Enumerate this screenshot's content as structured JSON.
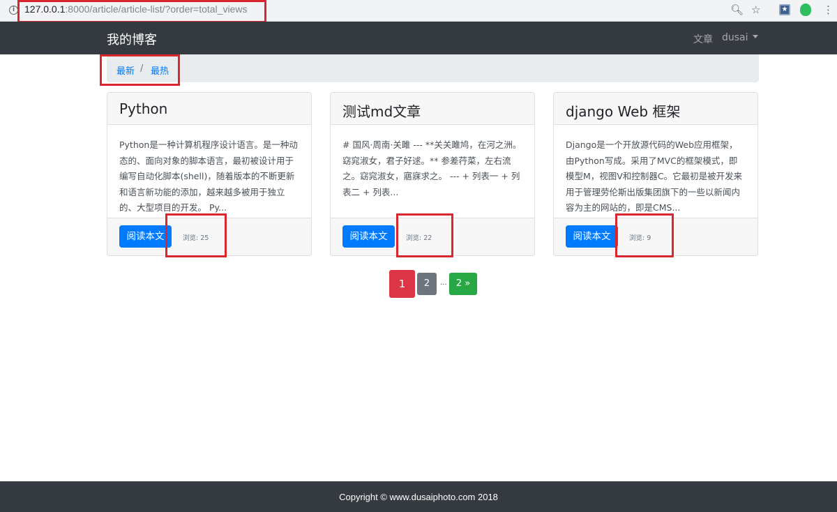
{
  "browser": {
    "url_host": "127.0.0.1",
    "url_rest": ":8000/article/article-list/?order=total_views",
    "icons": [
      "info-icon",
      "zoom-icon",
      "star-icon",
      "extension-icon",
      "evernote-icon",
      "menu-icon"
    ]
  },
  "navbar": {
    "brand": "我的博客",
    "links": [
      "文章",
      "dusai"
    ]
  },
  "breadcrumb": {
    "items": [
      "最新",
      "最热"
    ],
    "separator": "/"
  },
  "articles": [
    {
      "title": "Python",
      "body": "Python是一种计算机程序设计语言。是一种动态的、面向对象的脚本语言，最初被设计用于编写自动化脚本(shell)，随着版本的不断更新和语言新功能的添加，越来越多被用于独立的、大型项目的开发。 Py...",
      "button": "阅读本文",
      "views": "浏览: 25"
    },
    {
      "title": "测试md文章",
      "body": "# 国风·周南·关雎 --- **关关雎鸠，在河之洲。窈窕淑女，君子好逑。** 参差荇菜，左右流之。窈窕淑女，寤寐求之。 --- + 列表一 + 列表二 + 列表...",
      "button": "阅读本文",
      "views": "浏览: 22"
    },
    {
      "title": "django Web 框架",
      "body": "Django是一个开放源代码的Web应用框架，由Python写成。采用了MVC的框架模式，即模型M，视图V和控制器C。它最初是被开发来用于管理劳伦斯出版集团旗下的一些以新闻内容为主的网站的，即是CMS...",
      "button": "阅读本文",
      "views": "浏览: 9"
    }
  ],
  "pagination": {
    "current": "1",
    "page2": "2",
    "ellipsis": "...",
    "next": "2 »"
  },
  "colors": {
    "navbar": "#343a40",
    "primary": "#007bff",
    "danger": "#dc3545",
    "secondary": "#6c757d",
    "success": "#28a745",
    "annotation": "#d9262f"
  },
  "footer": {
    "text": "Copyright © www.dusaiphoto.com 2018"
  }
}
